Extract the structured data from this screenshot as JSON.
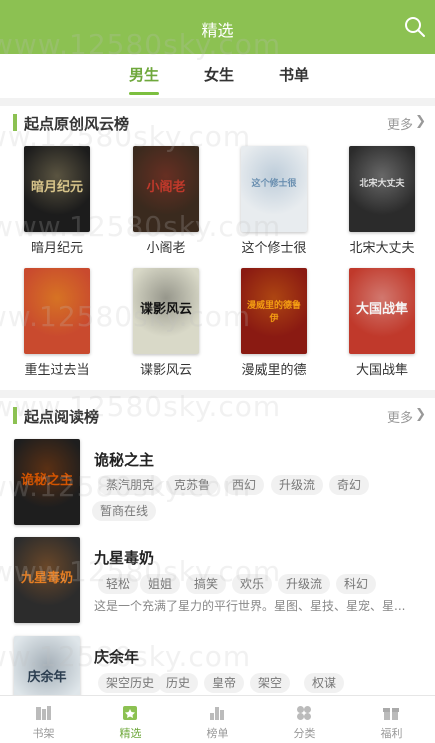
{
  "header": {
    "title": "精选",
    "search_icon": "search-icon"
  },
  "tabs": [
    {
      "label": "男生",
      "active": true
    },
    {
      "label": "女生",
      "active": false
    },
    {
      "label": "书单",
      "active": false
    }
  ],
  "ranking": {
    "title": "起点原创风云榜",
    "more": "更多",
    "books": [
      {
        "name": "暗月纪元",
        "cover_text": "暗月纪元",
        "bg": "#1c1c1c",
        "accent": "#d7c48a"
      },
      {
        "name": "小阁老",
        "cover_text": "小阁老",
        "bg": "#3a2a1e",
        "accent": "#c0392b"
      },
      {
        "name": "这个修士很",
        "cover_text": "这个修士很",
        "bg": "#e8ecef",
        "accent": "#6a8fb0"
      },
      {
        "name": "北宋大丈夫",
        "cover_text": "北宋大丈夫",
        "bg": "#2b2b2b",
        "accent": "#e0e0e0"
      },
      {
        "name": "重生过去当",
        "cover_text": "",
        "bg": "#c94a2e",
        "accent": "#f1c40f"
      },
      {
        "name": "谍影风云",
        "cover_text": "谍影风云",
        "bg": "#d9d9c8",
        "accent": "#111111"
      },
      {
        "name": "漫威里的德",
        "cover_text": "漫威里的德鲁伊",
        "bg": "#8a1a12",
        "accent": "#f39c12"
      },
      {
        "name": "大国战隼",
        "cover_text": "大国战隼",
        "bg": "#c0392b",
        "accent": "#f5f5f5"
      }
    ]
  },
  "reading": {
    "title": "起点阅读榜",
    "more": "更多",
    "books": [
      {
        "title": "诡秘之主",
        "cover_text": "诡秘之主",
        "bg": "#1e1e1e",
        "accent": "#d35400",
        "tags": [
          "蒸汽朋克",
          "克苏鲁",
          "西幻",
          "升级流",
          "奇幻",
          "暂商在线"
        ],
        "desc": ""
      },
      {
        "title": "九星毒奶",
        "cover_text": "九星毒奶",
        "bg": "#2c2c2c",
        "accent": "#e67e22",
        "tags": [
          "轻松",
          "姐姐",
          "搞笑",
          "欢乐",
          "升级流",
          "科幻"
        ],
        "desc": "这是一个充满了星力的平行世界。星图、星技、星宠、星..."
      },
      {
        "title": "庆余年",
        "cover_text": "庆余年",
        "bg": "#dfe6ea",
        "accent": "#2c3e50",
        "tags": [
          "架空历史",
          "历史",
          "皇帝",
          "架空",
          "权谋"
        ],
        "desc": ""
      }
    ]
  },
  "bottom_nav": [
    {
      "label": "书架",
      "icon": "bookshelf-icon",
      "active": false
    },
    {
      "label": "精选",
      "icon": "featured-icon",
      "active": true
    },
    {
      "label": "榜单",
      "icon": "chart-icon",
      "active": false
    },
    {
      "label": "分类",
      "icon": "category-icon",
      "active": false
    },
    {
      "label": "福利",
      "icon": "gift-icon",
      "active": false
    }
  ],
  "watermark": "www.12580sky.com",
  "colors": {
    "brand": "#8cc152",
    "active_text": "#6fa83c"
  }
}
